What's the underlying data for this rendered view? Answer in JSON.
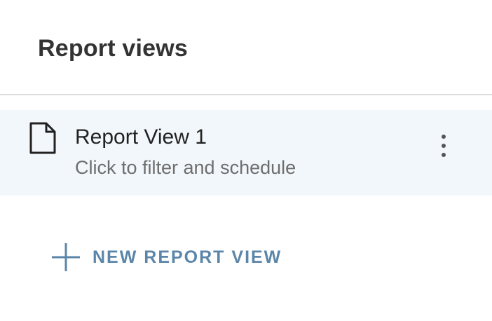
{
  "header": {
    "title": "Report views"
  },
  "views": [
    {
      "title": "Report View 1",
      "subtitle": "Click to filter and schedule",
      "icon": "document-icon",
      "menu_icon": "more-vertical-icon"
    }
  ],
  "actions": {
    "new_view_label": "NEW REPORT VIEW",
    "new_view_icon": "plus-icon"
  },
  "colors": {
    "accent": "#5b86a9",
    "row_background": "#f2f7fb",
    "divider": "#dcdcdc",
    "title_text": "#333333",
    "secondary_text": "#6e6e6e"
  }
}
